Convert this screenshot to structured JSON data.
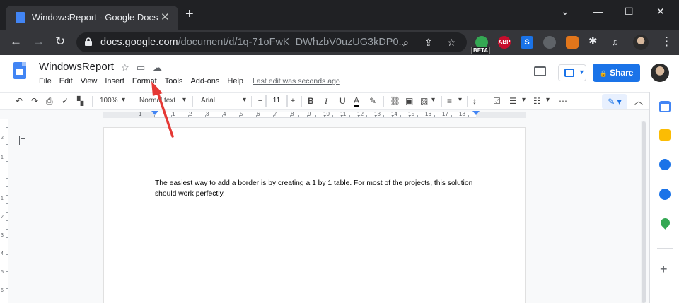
{
  "browser": {
    "tab_title": "WindowsReport - Google Docs",
    "tab_close": "✕",
    "new_tab": "+",
    "url_host": "docs.google.com",
    "url_path": "/document/d/1q-71oFwK_DWhzbV0uzUG3kDP0...",
    "window_controls": [
      "⌄",
      "—",
      "☐",
      "✕"
    ],
    "extensions": [
      {
        "name": "beta-extension-icon",
        "label": "",
        "color": "#34a853"
      },
      {
        "name": "adblock-plus-icon",
        "label": "ABP",
        "color": "#c70d2c"
      },
      {
        "name": "s-extension-icon",
        "label": "S",
        "color": "#1a73e8"
      },
      {
        "name": "robot-extension-icon",
        "label": "",
        "color": "#5f6368"
      },
      {
        "name": "metamask-icon",
        "label": "",
        "color": "#e2761b"
      },
      {
        "name": "puzzle-extensions-icon",
        "label": "",
        "color": "#35363a"
      }
    ],
    "beta_label": "BETA"
  },
  "docs": {
    "title": "WindowsReport",
    "menu": [
      "File",
      "Edit",
      "View",
      "Insert",
      "Format",
      "Tools",
      "Add-ons",
      "Help"
    ],
    "last_edit": "Last edit was seconds ago",
    "share_label": "Share",
    "share_icon": "🔒"
  },
  "format_toolbar": {
    "zoom": "100%",
    "style": "Normal text",
    "font": "Arial",
    "font_size": "11",
    "minus": "−",
    "plus": "+",
    "bold": "B",
    "italic": "I",
    "underline": "U",
    "text_color": "A",
    "more": "⋯",
    "collapse": "︿",
    "edit_mode_icon": "✎"
  },
  "ruler": {
    "numbers_top": [
      "1",
      "1",
      "2",
      "3",
      "4",
      "5",
      "6",
      "7",
      "8",
      "9",
      "10",
      "11",
      "12",
      "13",
      "14",
      "15",
      "16",
      "17",
      "18"
    ],
    "numbers_left": [
      "2",
      "1",
      "1",
      "2",
      "3",
      "4",
      "5",
      "6"
    ]
  },
  "page": {
    "body_text": "The easiest way to add a border is by creating a 1 by 1 table. For most of the projects, this solution should work perfectly."
  },
  "side_panel": {
    "icons": [
      {
        "name": "calendar-icon",
        "color": "#4285f4"
      },
      {
        "name": "keep-icon",
        "color": "#fbbc04"
      },
      {
        "name": "tasks-icon",
        "color": "#1a73e8"
      },
      {
        "name": "contacts-icon",
        "color": "#1a73e8"
      },
      {
        "name": "maps-icon",
        "color": "#34a853"
      }
    ],
    "add": "+"
  },
  "annotation": {
    "color": "#e53935"
  }
}
